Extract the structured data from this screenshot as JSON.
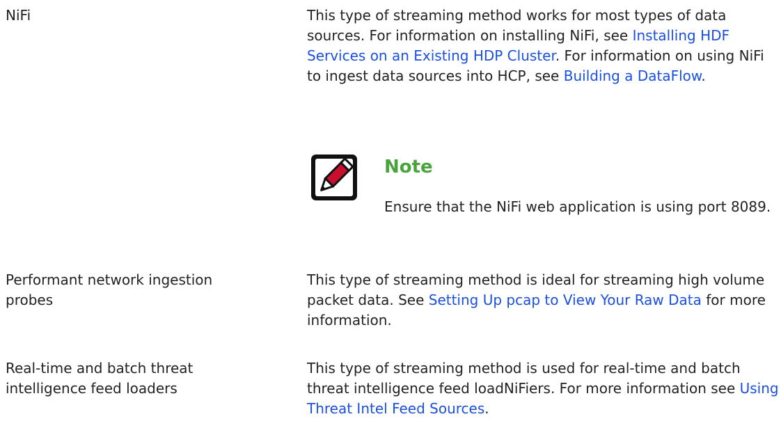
{
  "rows": [
    {
      "label": "NiFi",
      "desc": {
        "t1": "This type of streaming method works for most types of data sources. For information on installing NiFi, see ",
        "link1": "Installing HDF Services on an Existing HDP Cluster",
        "t2": ". For information on using NiFi to ingest data sources into HCP, see ",
        "link2": "Building a DataFlow",
        "t3": "."
      },
      "note": {
        "icon": "pencil-note-icon",
        "title": "Note",
        "text": "Ensure that the NiFi web application is using port 8089."
      }
    },
    {
      "label": "Performant network ingestion probes",
      "desc": {
        "t1": "This type of streaming method is ideal for streaming high volume packet data. See ",
        "link1": "Setting Up pcap to View Your Raw Data",
        "t2": " for more information."
      }
    },
    {
      "label": "Real-time and batch threat intelligence feed loaders",
      "desc": {
        "t1": "This type of streaming method is used for real-time and batch threat intelligence feed loadNiFiers. For more information see ",
        "link1": "Using Threat Intel Feed Sources",
        "t2": "."
      }
    }
  ],
  "colors": {
    "link": "#1a4fe0",
    "note_title": "#4aa43d",
    "text": "#222222"
  }
}
